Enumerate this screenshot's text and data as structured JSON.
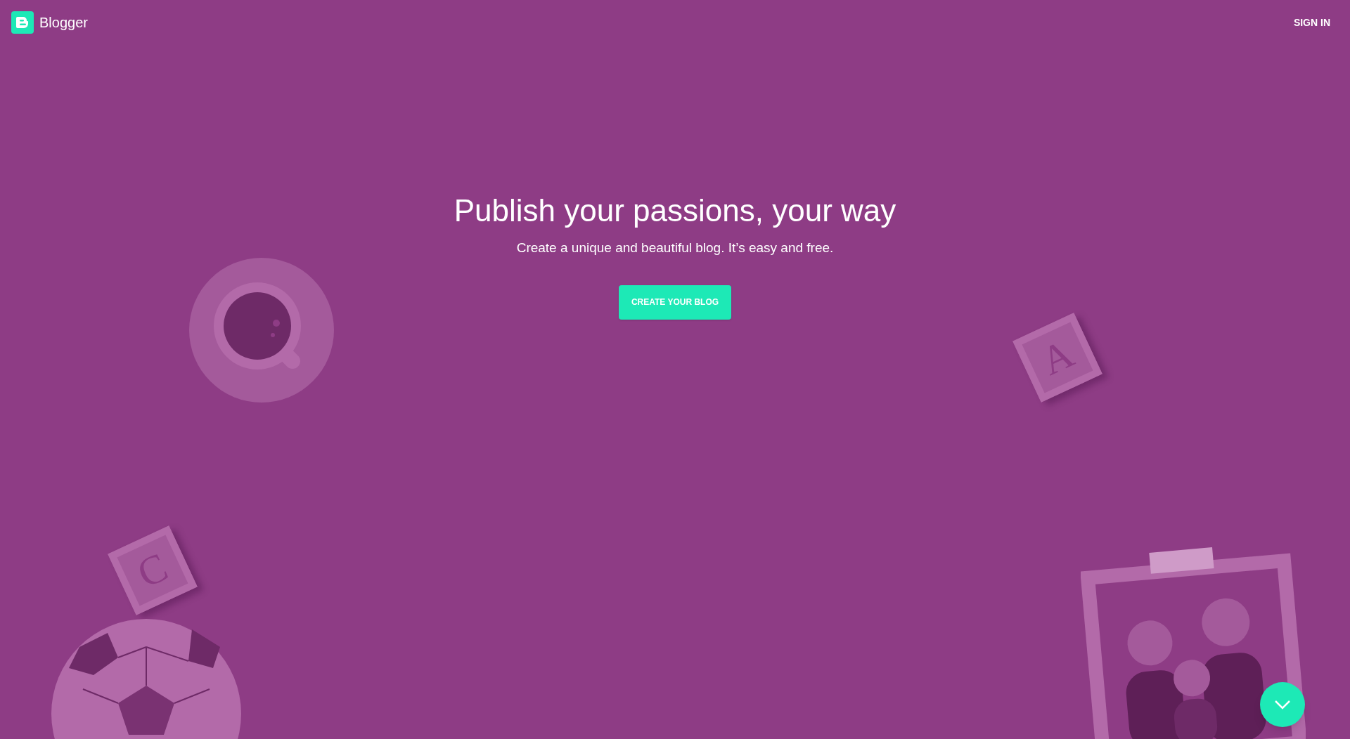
{
  "header": {
    "logo_text": "Blogger",
    "sign_in": "SIGN IN"
  },
  "hero": {
    "title": "Publish your passions, your way",
    "subtitle": "Create a unique and beautiful blog. It’s easy and free.",
    "button": "CREATE YOUR BLOG"
  },
  "letter_blocks": [
    {
      "letter": "A"
    },
    {
      "letter": "C"
    }
  ]
}
